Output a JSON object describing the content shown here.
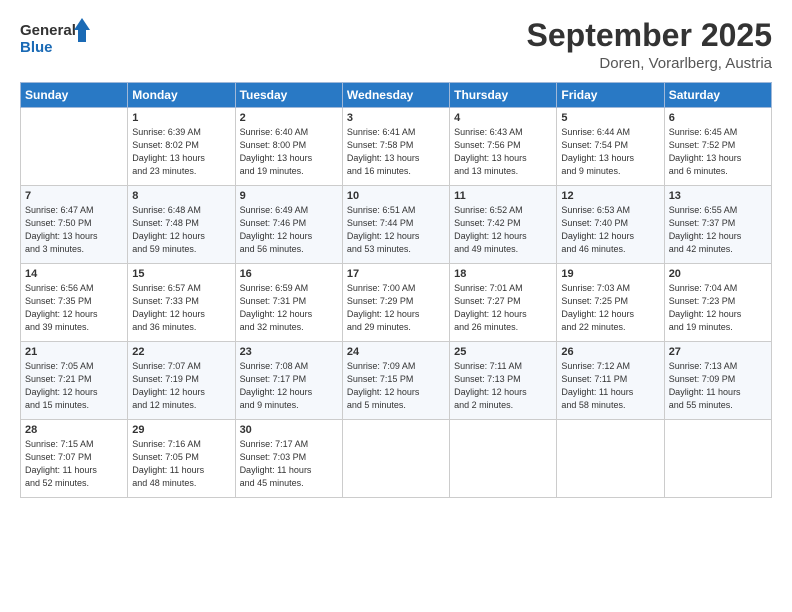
{
  "logo": {
    "line1": "General",
    "line2": "Blue"
  },
  "title": "September 2025",
  "location": "Doren, Vorarlberg, Austria",
  "days_of_week": [
    "Sunday",
    "Monday",
    "Tuesday",
    "Wednesday",
    "Thursday",
    "Friday",
    "Saturday"
  ],
  "weeks": [
    [
      {
        "num": "",
        "info": ""
      },
      {
        "num": "1",
        "info": "Sunrise: 6:39 AM\nSunset: 8:02 PM\nDaylight: 13 hours\nand 23 minutes."
      },
      {
        "num": "2",
        "info": "Sunrise: 6:40 AM\nSunset: 8:00 PM\nDaylight: 13 hours\nand 19 minutes."
      },
      {
        "num": "3",
        "info": "Sunrise: 6:41 AM\nSunset: 7:58 PM\nDaylight: 13 hours\nand 16 minutes."
      },
      {
        "num": "4",
        "info": "Sunrise: 6:43 AM\nSunset: 7:56 PM\nDaylight: 13 hours\nand 13 minutes."
      },
      {
        "num": "5",
        "info": "Sunrise: 6:44 AM\nSunset: 7:54 PM\nDaylight: 13 hours\nand 9 minutes."
      },
      {
        "num": "6",
        "info": "Sunrise: 6:45 AM\nSunset: 7:52 PM\nDaylight: 13 hours\nand 6 minutes."
      }
    ],
    [
      {
        "num": "7",
        "info": "Sunrise: 6:47 AM\nSunset: 7:50 PM\nDaylight: 13 hours\nand 3 minutes."
      },
      {
        "num": "8",
        "info": "Sunrise: 6:48 AM\nSunset: 7:48 PM\nDaylight: 12 hours\nand 59 minutes."
      },
      {
        "num": "9",
        "info": "Sunrise: 6:49 AM\nSunset: 7:46 PM\nDaylight: 12 hours\nand 56 minutes."
      },
      {
        "num": "10",
        "info": "Sunrise: 6:51 AM\nSunset: 7:44 PM\nDaylight: 12 hours\nand 53 minutes."
      },
      {
        "num": "11",
        "info": "Sunrise: 6:52 AM\nSunset: 7:42 PM\nDaylight: 12 hours\nand 49 minutes."
      },
      {
        "num": "12",
        "info": "Sunrise: 6:53 AM\nSunset: 7:40 PM\nDaylight: 12 hours\nand 46 minutes."
      },
      {
        "num": "13",
        "info": "Sunrise: 6:55 AM\nSunset: 7:37 PM\nDaylight: 12 hours\nand 42 minutes."
      }
    ],
    [
      {
        "num": "14",
        "info": "Sunrise: 6:56 AM\nSunset: 7:35 PM\nDaylight: 12 hours\nand 39 minutes."
      },
      {
        "num": "15",
        "info": "Sunrise: 6:57 AM\nSunset: 7:33 PM\nDaylight: 12 hours\nand 36 minutes."
      },
      {
        "num": "16",
        "info": "Sunrise: 6:59 AM\nSunset: 7:31 PM\nDaylight: 12 hours\nand 32 minutes."
      },
      {
        "num": "17",
        "info": "Sunrise: 7:00 AM\nSunset: 7:29 PM\nDaylight: 12 hours\nand 29 minutes."
      },
      {
        "num": "18",
        "info": "Sunrise: 7:01 AM\nSunset: 7:27 PM\nDaylight: 12 hours\nand 26 minutes."
      },
      {
        "num": "19",
        "info": "Sunrise: 7:03 AM\nSunset: 7:25 PM\nDaylight: 12 hours\nand 22 minutes."
      },
      {
        "num": "20",
        "info": "Sunrise: 7:04 AM\nSunset: 7:23 PM\nDaylight: 12 hours\nand 19 minutes."
      }
    ],
    [
      {
        "num": "21",
        "info": "Sunrise: 7:05 AM\nSunset: 7:21 PM\nDaylight: 12 hours\nand 15 minutes."
      },
      {
        "num": "22",
        "info": "Sunrise: 7:07 AM\nSunset: 7:19 PM\nDaylight: 12 hours\nand 12 minutes."
      },
      {
        "num": "23",
        "info": "Sunrise: 7:08 AM\nSunset: 7:17 PM\nDaylight: 12 hours\nand 9 minutes."
      },
      {
        "num": "24",
        "info": "Sunrise: 7:09 AM\nSunset: 7:15 PM\nDaylight: 12 hours\nand 5 minutes."
      },
      {
        "num": "25",
        "info": "Sunrise: 7:11 AM\nSunset: 7:13 PM\nDaylight: 12 hours\nand 2 minutes."
      },
      {
        "num": "26",
        "info": "Sunrise: 7:12 AM\nSunset: 7:11 PM\nDaylight: 11 hours\nand 58 minutes."
      },
      {
        "num": "27",
        "info": "Sunrise: 7:13 AM\nSunset: 7:09 PM\nDaylight: 11 hours\nand 55 minutes."
      }
    ],
    [
      {
        "num": "28",
        "info": "Sunrise: 7:15 AM\nSunset: 7:07 PM\nDaylight: 11 hours\nand 52 minutes."
      },
      {
        "num": "29",
        "info": "Sunrise: 7:16 AM\nSunset: 7:05 PM\nDaylight: 11 hours\nand 48 minutes."
      },
      {
        "num": "30",
        "info": "Sunrise: 7:17 AM\nSunset: 7:03 PM\nDaylight: 11 hours\nand 45 minutes."
      },
      {
        "num": "",
        "info": ""
      },
      {
        "num": "",
        "info": ""
      },
      {
        "num": "",
        "info": ""
      },
      {
        "num": "",
        "info": ""
      }
    ]
  ]
}
